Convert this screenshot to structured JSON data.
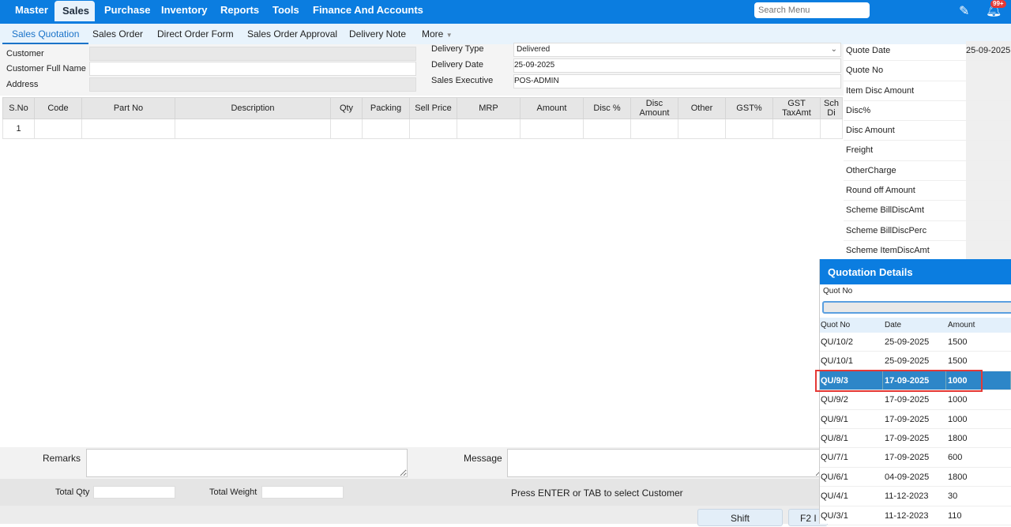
{
  "topnav": {
    "items": [
      "Master",
      "Sales",
      "Purchase",
      "Inventory",
      "Reports",
      "Tools",
      "Finance And Accounts"
    ],
    "search_placeholder": "Search Menu",
    "badge": "99+"
  },
  "subnav": {
    "tabs": [
      "Sales Quotation",
      "Sales Order",
      "Direct Order Form",
      "Sales Order Approval",
      "Delivery Note",
      "More"
    ]
  },
  "form": {
    "customer": "Customer",
    "customer_full_name": "Customer Full Name",
    "address": "Address",
    "delivery_type_label": "Delivery Type",
    "delivery_type": "Delivered",
    "delivery_date_label": "Delivery Date",
    "delivery_date": "25-09-2025",
    "sales_exec_label": "Sales Executive",
    "sales_exec": "POS-ADMIN"
  },
  "grid": {
    "headers": [
      "S.No",
      "Code",
      "Part No",
      "Description",
      "Qty",
      "Packing",
      "Sell Price",
      "MRP",
      "Amount",
      "Disc %",
      "Disc Amount",
      "Other",
      "GST%",
      "GST TaxAmt",
      "Sch Di"
    ],
    "rows": [
      [
        "1",
        "",
        "",
        "",
        "",
        "",
        "",
        "",
        "",
        "",
        "",
        "",
        "",
        "",
        ""
      ]
    ]
  },
  "summary": [
    {
      "k": "Quote Date",
      "v": "25-09-2025"
    },
    {
      "k": "Quote No",
      "v": ""
    },
    {
      "k": "Item Disc Amount",
      "v": ""
    },
    {
      "k": "Disc%",
      "v": ""
    },
    {
      "k": "Disc Amount",
      "v": ""
    },
    {
      "k": "Freight",
      "v": ""
    },
    {
      "k": "OtherCharge",
      "v": ""
    },
    {
      "k": "Round off Amount",
      "v": ""
    },
    {
      "k": "Scheme BillDiscAmt",
      "v": ""
    },
    {
      "k": "Scheme BillDiscPerc",
      "v": ""
    },
    {
      "k": "Scheme ItemDiscAmt",
      "v": ""
    }
  ],
  "popup": {
    "title": "Quotation Details",
    "filter_label": "Quot No",
    "columns": [
      "Quot No",
      "Date",
      "Amount"
    ],
    "rows": [
      [
        "QU/10/2",
        "25-09-2025",
        "1500"
      ],
      [
        "QU/10/1",
        "25-09-2025",
        "1500"
      ],
      [
        "QU/9/3",
        "17-09-2025",
        "1000"
      ],
      [
        "QU/9/2",
        "17-09-2025",
        "1000"
      ],
      [
        "QU/9/1",
        "17-09-2025",
        "1000"
      ],
      [
        "QU/8/1",
        "17-09-2025",
        "1800"
      ],
      [
        "QU/7/1",
        "17-09-2025",
        "600"
      ],
      [
        "QU/6/1",
        "04-09-2025",
        "1800"
      ],
      [
        "QU/4/1",
        "11-12-2023",
        "30"
      ],
      [
        "QU/3/1",
        "11-12-2023",
        "110"
      ]
    ],
    "selected_index": 2
  },
  "footer": {
    "remarks": "Remarks",
    "message": "Message",
    "total_qty": "Total Qty",
    "total_weight": "Total Weight",
    "hint": "Press ENTER or TAB to select Customer",
    "shift": "Shift",
    "f2": "F2 I"
  }
}
